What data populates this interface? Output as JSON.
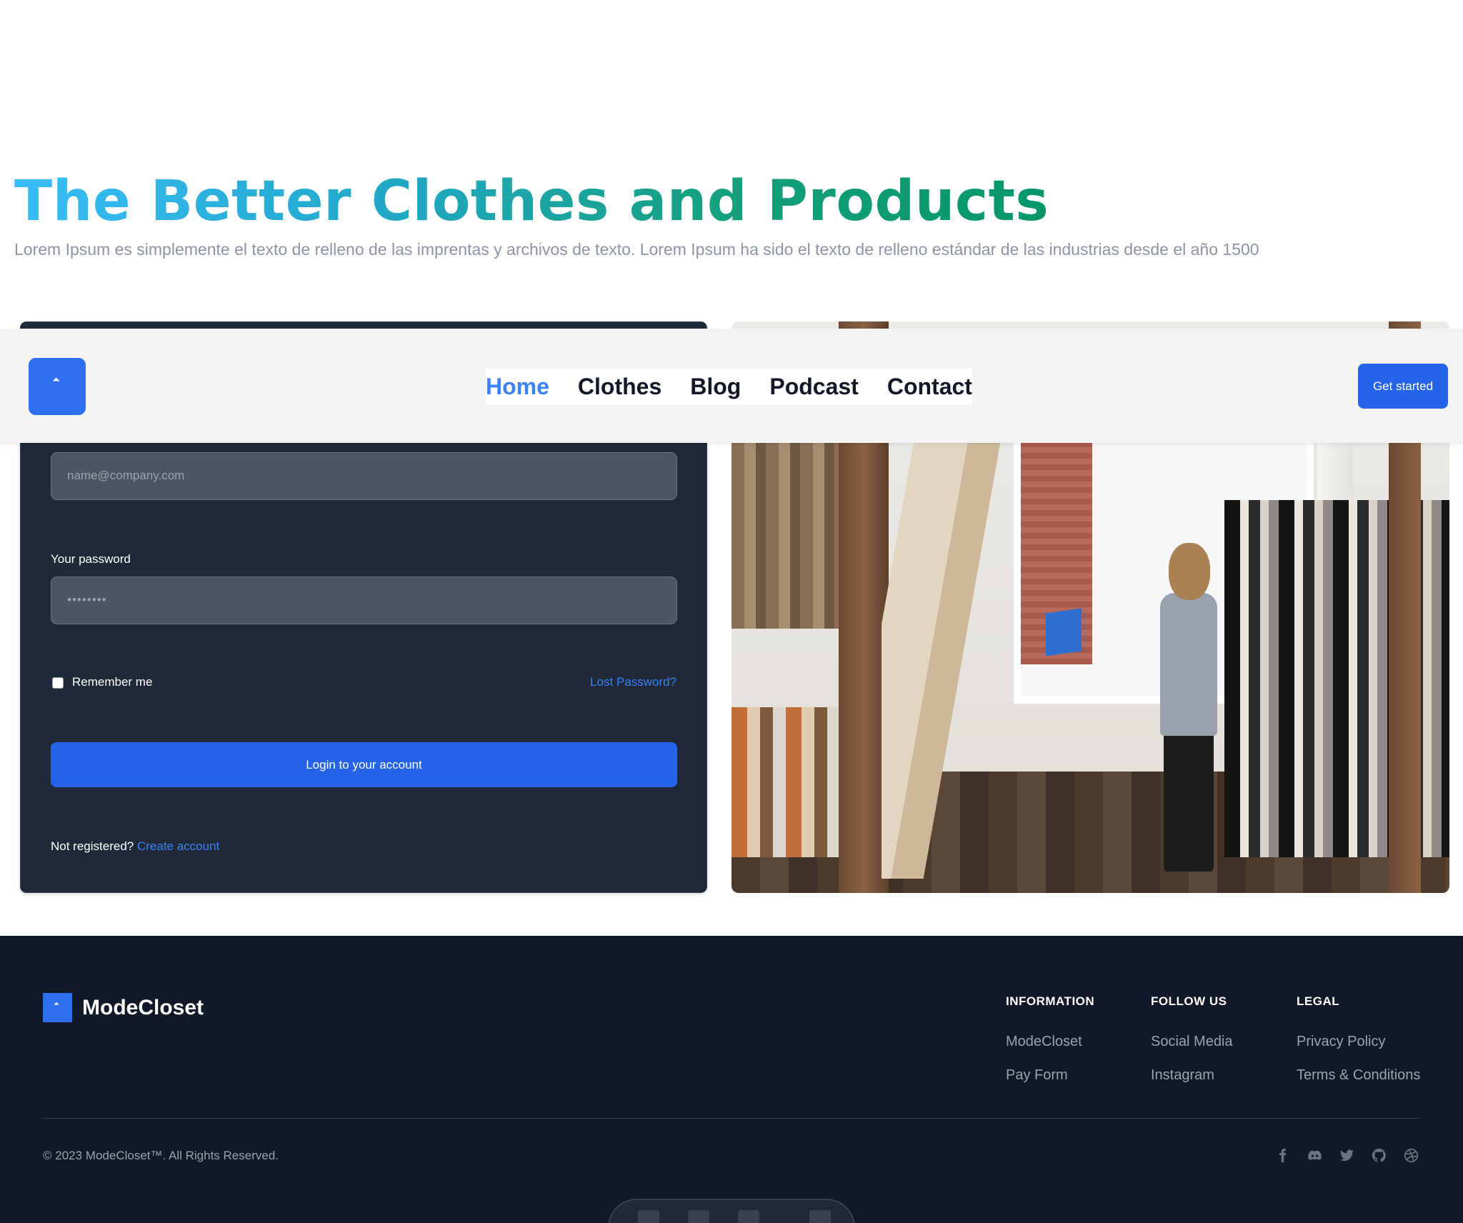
{
  "hero": {
    "title": "The Better Clothes and Products",
    "subtitle": "Lorem Ipsum es simplemente el texto de relleno de las imprentas y archivos de texto. Lorem Ipsum ha sido el texto de relleno estándar de las industrias desde el año 1500"
  },
  "navbar": {
    "logo_icon": "logo-mark-icon",
    "menu": [
      {
        "label": "Home",
        "active": true
      },
      {
        "label": "Clothes",
        "active": false
      },
      {
        "label": "Blog",
        "active": false
      },
      {
        "label": "Podcast",
        "active": false
      },
      {
        "label": "Contact",
        "active": false
      }
    ],
    "cta_label": "Get started"
  },
  "login": {
    "email_placeholder": "name@company.com",
    "password_label": "Your password",
    "password_value": "••••••••",
    "remember_label": "Remember me",
    "remember_checked": false,
    "lost_password": "Lost Password?",
    "submit_label": "Login to your account",
    "not_registered": "Not registered?",
    "create_account": "Create account"
  },
  "store_image": {
    "subject": "clothing-store-photo"
  },
  "footer": {
    "brand": "ModeCloset",
    "columns": [
      {
        "title": "INFORMATION",
        "links": [
          "ModeCloset",
          "Pay Form"
        ]
      },
      {
        "title": "FOLLOW US",
        "links": [
          "Social Media",
          "Instagram"
        ]
      },
      {
        "title": "LEGAL",
        "links": [
          "Privacy Policy",
          "Terms & Conditions"
        ]
      }
    ],
    "copyright": "© 2023 ModeCloset™. All Rights Reserved.",
    "social_icons": [
      "facebook-icon",
      "discord-icon",
      "twitter-icon",
      "github-icon",
      "dribbble-icon"
    ]
  },
  "colors": {
    "accent": "#2563eb",
    "link": "#3b82f6",
    "card_bg": "#1f2937",
    "footer_bg": "#111827",
    "title_gradient_start": "#38bdf8",
    "title_gradient_end": "#059669"
  }
}
